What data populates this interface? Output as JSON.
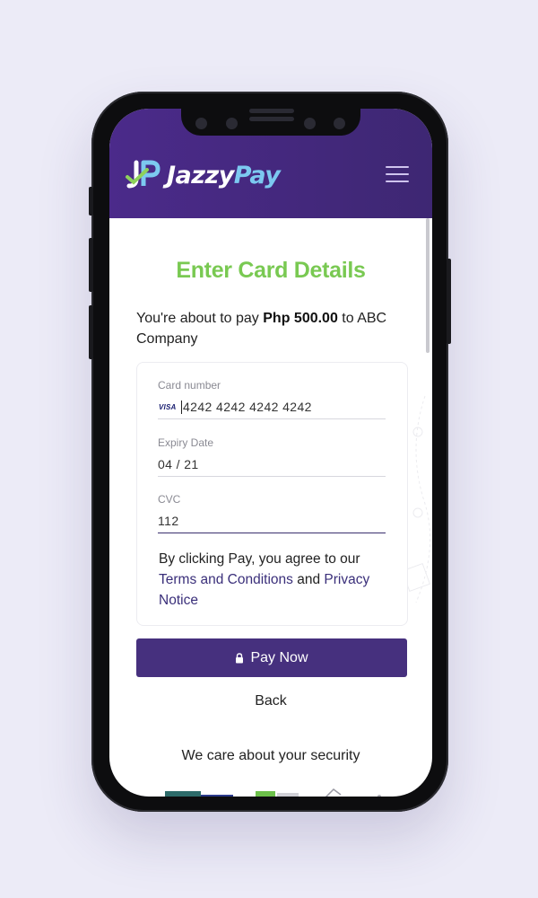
{
  "header": {
    "logo_primary": "Jazzy",
    "logo_secondary": "Pay",
    "logo_icon": "jp-monogram-icon"
  },
  "page": {
    "title": "Enter Card Details",
    "pay_prefix": "You're about to pay ",
    "amount": "Php 500.00",
    "pay_suffix": " to ABC Company"
  },
  "form": {
    "card_number_label": "Card number",
    "card_brand": "VISA",
    "card_number_value": "4242 4242 4242 4242",
    "expiry_label": "Expiry Date",
    "expiry_value": "04 / 21",
    "cvc_label": "CVC",
    "cvc_value": "112",
    "agree_prefix": "By clicking Pay, you agree to our ",
    "terms_link": "Terms and Conditions",
    "agree_and": " and ",
    "privacy_link": "Privacy Notice"
  },
  "actions": {
    "pay_label": "Pay Now",
    "back_label": "Back"
  },
  "footer": {
    "security_text": "We care about your security"
  },
  "colors": {
    "header_bg": "#4b2a8a",
    "title_green": "#79c952",
    "button_purple": "#46307e",
    "link_purple": "#3a2f7a"
  }
}
